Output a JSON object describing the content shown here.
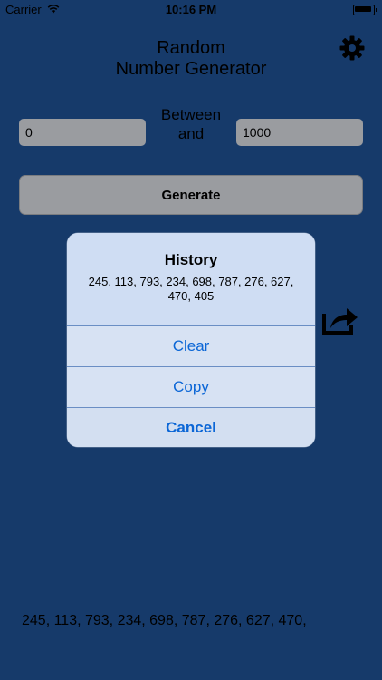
{
  "status_bar": {
    "carrier": "Carrier",
    "time": "10:16 PM"
  },
  "app": {
    "title_line1": "Random",
    "title_line2": "Number Generator",
    "between_label_1": "Between",
    "between_label_2": "and",
    "min_value": "0",
    "max_value": "1000",
    "generate_label": "Generate",
    "result_text": "245, 113, 793, 234, 698, 787, 276, 627, 470,"
  },
  "alert": {
    "title": "History",
    "message": "245, 113, 793, 234, 698, 787, 276, 627, 470, 405",
    "buttons": [
      "Clear",
      "Copy",
      "Cancel"
    ]
  },
  "icons": {
    "settings": "gear-icon",
    "share": "share-icon",
    "wifi": "wifi-icon",
    "battery": "battery-icon"
  },
  "colors": {
    "background": "#163a6a",
    "accent": "#0b66d6",
    "field": "#9a9ca0"
  }
}
